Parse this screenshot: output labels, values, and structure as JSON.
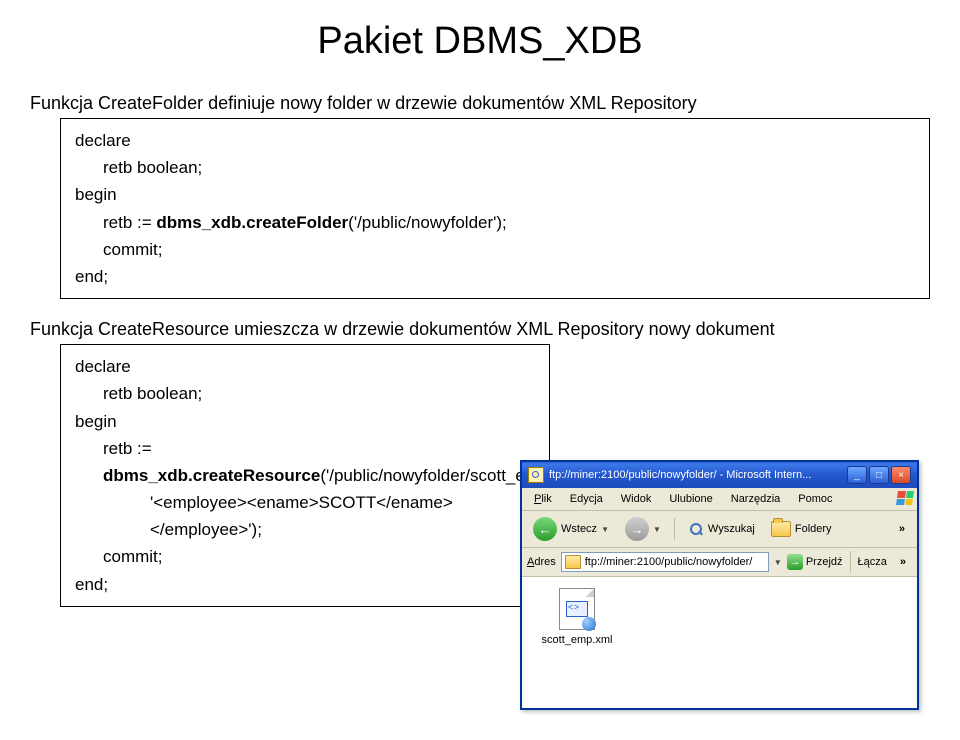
{
  "title": "Pakiet DBMS_XDB",
  "desc1": "Funkcja CreateFolder definiuje nowy folder w drzewie dokumentów XML Repository",
  "code1": {
    "l1": "declare",
    "l2": "retb boolean;",
    "l3": "begin",
    "l4a": "retb := ",
    "l4b": "dbms_xdb.createFolder",
    "l4c": "('/public/nowyfolder');",
    "l5": "commit;",
    "l6": "end;"
  },
  "desc2": "Funkcja CreateResource umieszcza w drzewie dokumentów XML Repository nowy dokument",
  "code2": {
    "l1": "declare",
    "l2": "retb boolean;",
    "l3": "begin",
    "l4a": "retb := ",
    "l4b": "dbms_xdb.createResource",
    "l4c": "('/public/nowyfolder/scott_emp.xml',",
    "l5": "'<employee><ename>SCOTT</ename></employee>');",
    "l6": "commit;",
    "l7": "end;"
  },
  "browser": {
    "title": "ftp://miner:2100/public/nowyfolder/ - Microsoft Intern...",
    "menu": {
      "m1": "Plik",
      "m2": "Edycja",
      "m3": "Widok",
      "m4": "Ulubione",
      "m5": "Narzędzia",
      "m6": "Pomoc"
    },
    "toolbar": {
      "back": "Wstecz",
      "search": "Wyszukaj",
      "folders": "Foldery"
    },
    "address": {
      "label": "Adres",
      "value": "ftp://miner:2100/public/nowyfolder/",
      "go": "Przejdź",
      "links": "Łącza"
    },
    "file": "scott_emp.xml"
  }
}
